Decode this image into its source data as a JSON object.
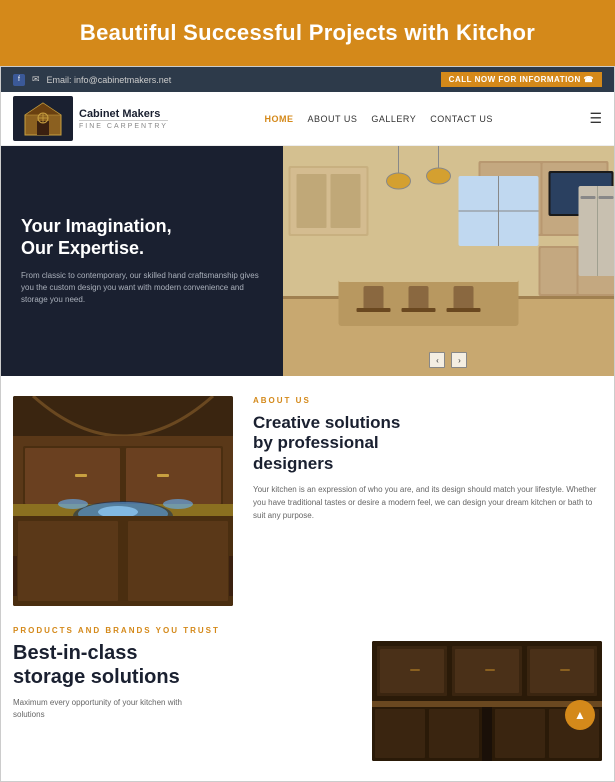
{
  "hero_banner": {
    "title": "Beautiful Successful Projects with Kitchor"
  },
  "topbar": {
    "email_label": "Email: info@cabinetmakers.net",
    "cta_button": "CALL NOW FOR INFORMATION ☎"
  },
  "navbar": {
    "logo_text": "Cabinet Makers",
    "logo_sub": "FINE CARPENTRY",
    "links": [
      "HOME",
      "ABOUT US",
      "GALLERY",
      "CONTACT US"
    ]
  },
  "hero": {
    "heading_line1": "Your Imagination,",
    "heading_line2": "Our Expertise.",
    "description": "From classic to contemporary, our skilled hand craftsmanship gives you the custom design you want with modern convenience and storage you need."
  },
  "about": {
    "section_label": "ABOUT US",
    "title_line1": "Creative solutions",
    "title_line2": "by professional",
    "title_line3": "designers",
    "description": "Your kitchen is an expression of who you are, and its design should match your lifestyle. Whether you have traditional tastes or desire a modern feel, we can design your dream kitchen or bath to suit any purpose."
  },
  "products": {
    "section_label": "PRODUCTS AND BRANDS YOU TRUST",
    "title_line1": "Best-in-class",
    "title_line2": "storage solutions",
    "description": "Maximum every opportunity of your kitchen with solutions"
  },
  "carousel": {
    "prev_label": "‹",
    "next_label": "›"
  },
  "scroll_btn": "▲"
}
